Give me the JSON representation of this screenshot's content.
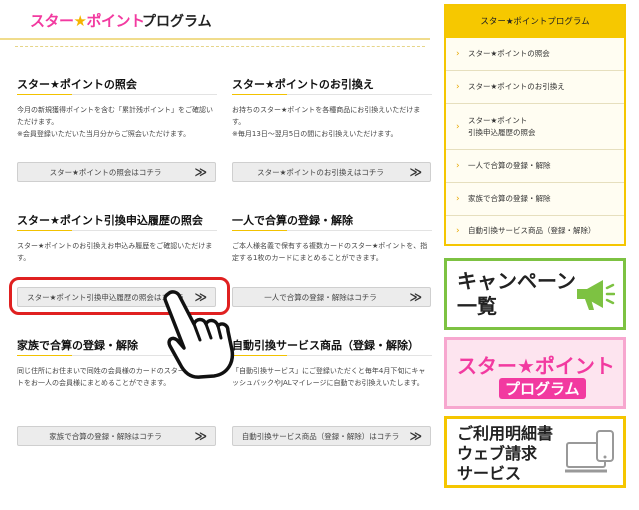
{
  "header": {
    "logo_text": "スター",
    "logo_star": "★",
    "logo_text2": "ポイント",
    "title_rest": "プログラム"
  },
  "cards": [
    {
      "title": "スター★ポイントの照会",
      "desc": "今月の新規獲得ポイントを含む「累計残ポイント」をご確認いただけます。\n※会員登録いただいた当月分からご照会いただけます。",
      "button": "スター★ポイントの照会はコチラ"
    },
    {
      "title": "スター★ポイントのお引換え",
      "desc": "お持ちのスター★ポイントを各種商品にお引換えいただけます。\n※毎月13日～翌月5日の間にお引換えいただけます。",
      "button": "スター★ポイントのお引換えはコチラ"
    },
    {
      "title": "スター★ポイント引換申込履歴の照会",
      "desc": "スター★ポイントのお引換えお申込み履歴をご確認いただけます。",
      "button": "スター★ポイント引換申込履歴の照会はコチラ"
    },
    {
      "title": "一人で合算の登録・解除",
      "desc": "ご本人様名義で保有する複数カードのスター★ポイントを、指定する1枚のカードにまとめることができます。",
      "button": "一人で合算の登録・解除はコチラ"
    },
    {
      "title": "家族で合算の登録・解除",
      "desc": "同じ住所にお住まいで同姓の会員様のカードのスター★ポイントをお一人の会員様にまとめることができます。",
      "button": "家族で合算の登録・解除はコチラ"
    },
    {
      "title": "自動引換サービス商品（登録・解除）",
      "desc": "「自動引換サービス」にご登録いただくと毎年4月下旬にキャッシュバックやJALマイレージに自動でお引換えいたします。",
      "button": "自動引換サービス商品（登録・解除）はコチラ"
    }
  ],
  "button_chevron": "≫",
  "sidebar": {
    "title": "スター★ポイントプログラム",
    "arrow": "›",
    "items": [
      "スター★ポイントの照会",
      "スター★ポイントのお引換え",
      "スター★ポイント\n引換申込履歴の照会",
      "一人で合算の登録・解除",
      "家族で合算の登録・解除",
      "自動引換サービス商品（登録・解除）"
    ]
  },
  "banners": {
    "campaign": "キャンペーン\n一覧",
    "star_line1": "スター★ポイント",
    "star_line2": "プログラム",
    "detail": "ご利用明細書\nウェブ請求\nサービス"
  },
  "colors": {
    "accent_yellow": "#f6c800",
    "brand_pink": "#f23aa0",
    "highlight_red": "#e02020",
    "campaign_green": "#7dc242"
  },
  "icons": [
    "megaphone-icon",
    "hand-pointer-icon",
    "pc-phone-icon",
    "chevron-right-icon"
  ]
}
